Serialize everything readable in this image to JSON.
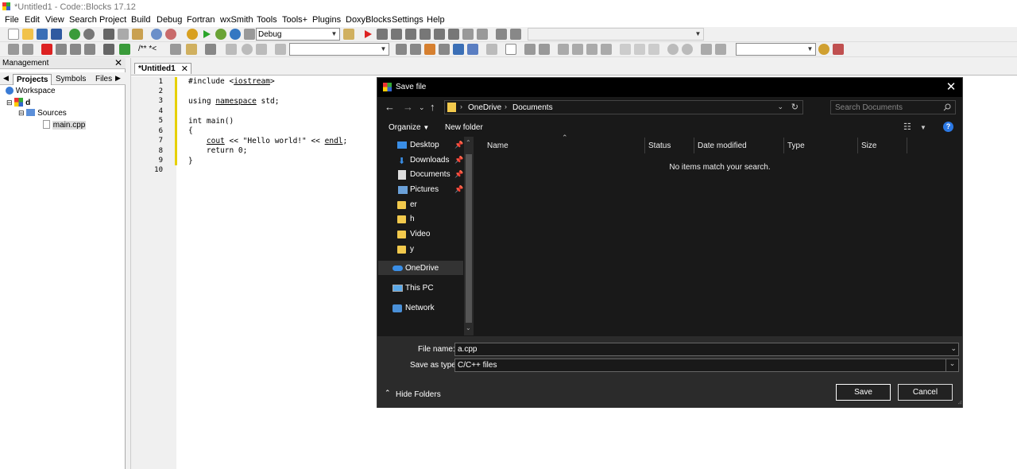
{
  "window": {
    "title": "*Untitled1 - Code::Blocks 17.12"
  },
  "menu": [
    "File",
    "Edit",
    "View",
    "Search",
    "Project",
    "Build",
    "Debug",
    "Fortran",
    "wxSmith",
    "Tools",
    "Tools+",
    "Plugins",
    "DoxyBlocks",
    "Settings",
    "Help"
  ],
  "toolbar": {
    "build_target": "Debug",
    "doxy_label": "/** *<"
  },
  "management": {
    "title": "Management",
    "tabs": [
      "Projects",
      "Symbols",
      "Files"
    ],
    "tree": {
      "workspace": "Workspace",
      "project": "d",
      "folder": "Sources",
      "file": "main.cpp"
    }
  },
  "editor": {
    "tab": "*Untitled1",
    "line_numbers": [
      "1",
      "2",
      "3",
      "4",
      "5",
      "6",
      "7",
      "8",
      "9",
      "10"
    ]
  },
  "dialog": {
    "title": "Save file",
    "breadcrumb": [
      "OneDrive",
      "Documents"
    ],
    "search_placeholder": "Search Documents",
    "organize": "Organize",
    "new_folder": "New folder",
    "nav": {
      "quick": [
        "Desktop",
        "Downloads",
        "Documents",
        "Pictures"
      ],
      "folders": [
        "er",
        "h",
        "Video",
        "y"
      ],
      "onedrive": "OneDrive",
      "thispc": "This PC",
      "network": "Network"
    },
    "columns": [
      "Name",
      "Status",
      "Date modified",
      "Type",
      "Size"
    ],
    "empty_message": "No items match your search.",
    "file_name_label": "File name:",
    "file_name_value": "a.cpp",
    "save_as_type_label": "Save as type:",
    "save_as_type_value": "C/C++ files",
    "hide_folders": "Hide Folders",
    "save": "Save",
    "cancel": "Cancel"
  }
}
